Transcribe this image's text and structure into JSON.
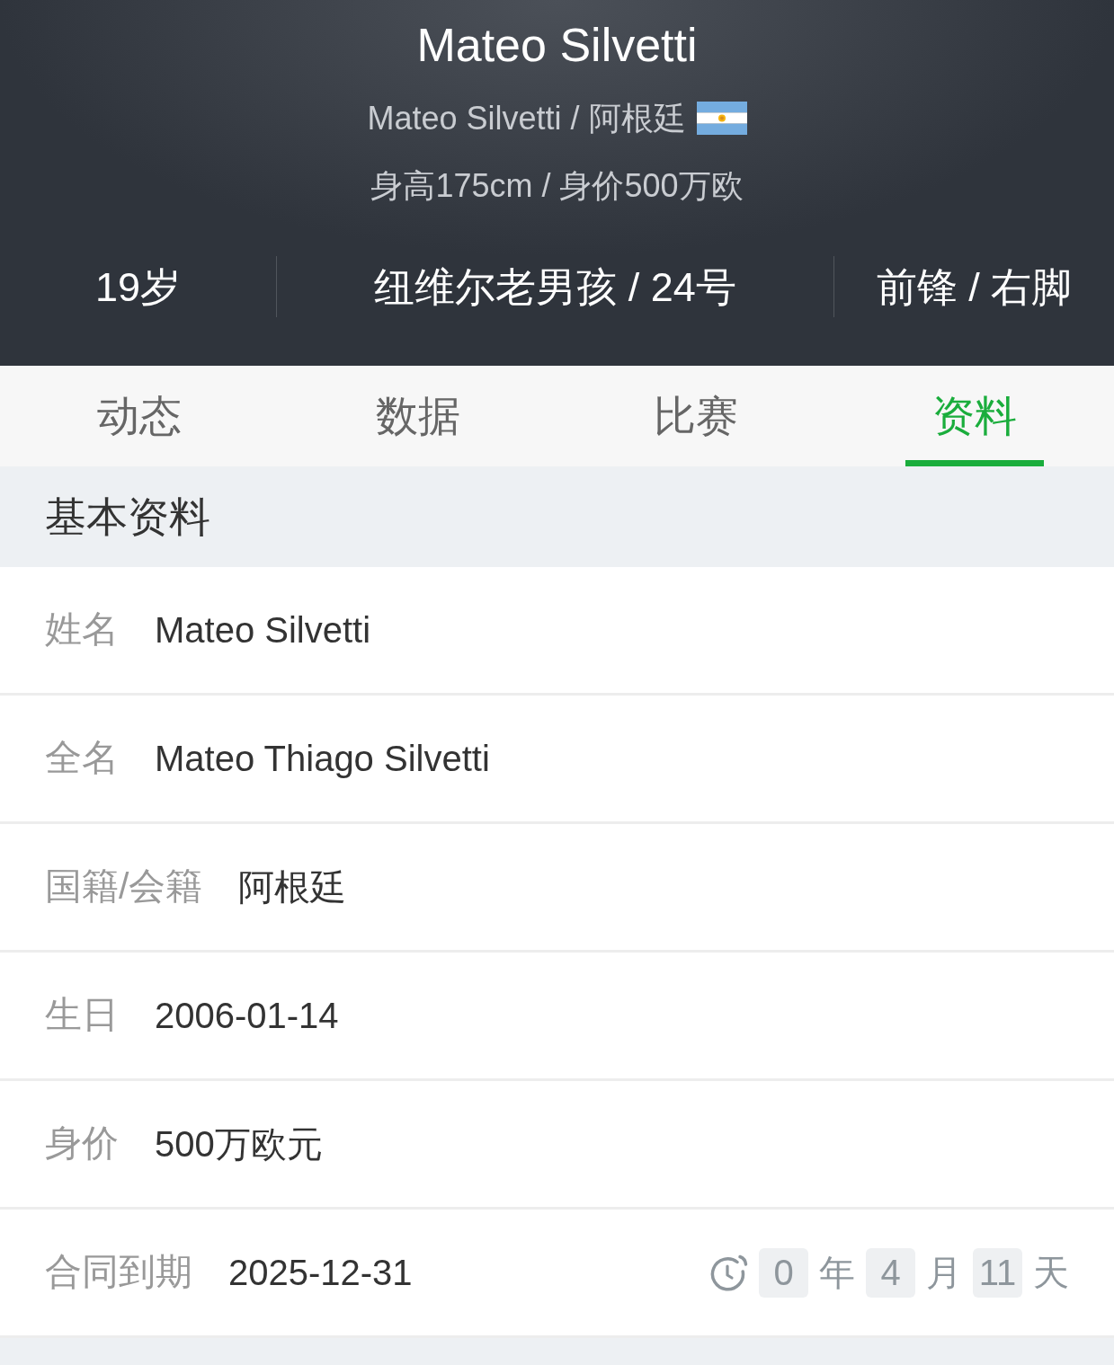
{
  "header": {
    "title": "Mateo Silvetti",
    "subtitle": "Mateo Silvetti / 阿根廷",
    "details": "身高175cm / 身价500万欧",
    "stats": [
      "19岁",
      "纽维尔老男孩 / 24号",
      "前锋 / 右脚"
    ]
  },
  "tabs": [
    {
      "label": "动态",
      "selected": false
    },
    {
      "label": "数据",
      "selected": false
    },
    {
      "label": "比赛",
      "selected": false
    },
    {
      "label": "资料",
      "selected": true
    }
  ],
  "section": {
    "title": "基本资料"
  },
  "rows": [
    {
      "kind": "text",
      "label": "姓名",
      "value": "Mateo Silvetti"
    },
    {
      "kind": "text",
      "label": "全名",
      "value": "Mateo Thiago Silvetti"
    },
    {
      "kind": "text",
      "label": "国籍/会籍",
      "value": "阿根廷"
    },
    {
      "kind": "text",
      "label": "生日",
      "value": "2006-01-14"
    },
    {
      "kind": "text",
      "label": "身价",
      "value": "500万欧元"
    },
    {
      "kind": "contract",
      "label": "合同到期",
      "value": "2025-12-31",
      "countdown": [
        {
          "number": "0",
          "unit": "年"
        },
        {
          "number": "4",
          "unit": "月"
        },
        {
          "number": "11",
          "unit": "天"
        }
      ]
    }
  ]
}
